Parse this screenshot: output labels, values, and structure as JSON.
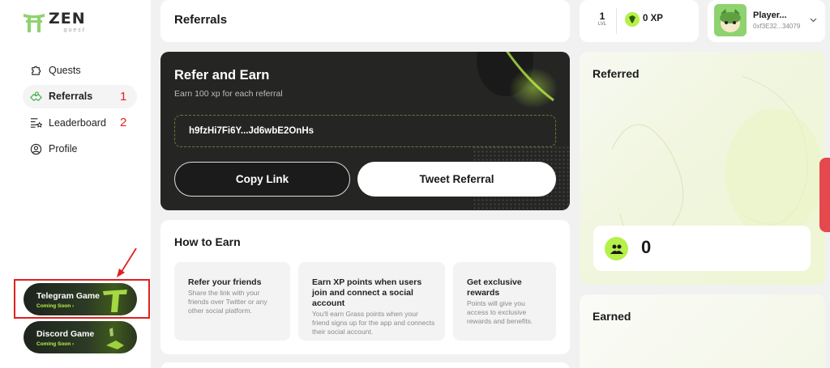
{
  "brand": {
    "name": "ZEN",
    "tagline": "quest"
  },
  "sidebar": {
    "items": [
      {
        "label": "Quests",
        "icon": "puzzle-icon",
        "annotation": ""
      },
      {
        "label": "Referrals",
        "icon": "handshake-icon",
        "annotation": "1",
        "active": true
      },
      {
        "label": "Leaderboard",
        "icon": "leaderboard-icon",
        "annotation": "2"
      },
      {
        "label": "Profile",
        "icon": "user-icon",
        "annotation": ""
      }
    ],
    "games": [
      {
        "title": "Telegram Game",
        "status": "Coming Soon"
      },
      {
        "title": "Discord Game",
        "status": "Coming Soon"
      }
    ]
  },
  "page": {
    "title": "Referrals"
  },
  "refer_card": {
    "title": "Refer and Earn",
    "subtitle": "Earn 100 xp for each referral",
    "code": "h9fzHi7Fi6Y...Jd6wbE2OnHs",
    "copy_label": "Copy Link",
    "tweet_label": "Tweet Referral"
  },
  "how_to_earn": {
    "title": "How to Earn",
    "steps": [
      {
        "title": "Refer your friends",
        "desc": "Share the link with your friends over Twitter or any other social platform."
      },
      {
        "title": "Earn XP points when users join and connect a social account",
        "desc": "You'll earn Grass points when your friend signs up for the app and connects their social account."
      },
      {
        "title": "Get exclusive rewards",
        "desc": "Points will give you access to exclusive rewards and benefits."
      }
    ]
  },
  "stats": {
    "level": "1",
    "level_label": "LVL",
    "xp": "0 XP"
  },
  "user": {
    "name": "Player...",
    "address": "0xf3E32...34079"
  },
  "referred": {
    "title": "Referred",
    "count": "0"
  },
  "earned": {
    "title": "Earned"
  },
  "colors": {
    "accent": "#b6f04a",
    "dark_card": "#252624",
    "annotation_red": "#e02020"
  }
}
